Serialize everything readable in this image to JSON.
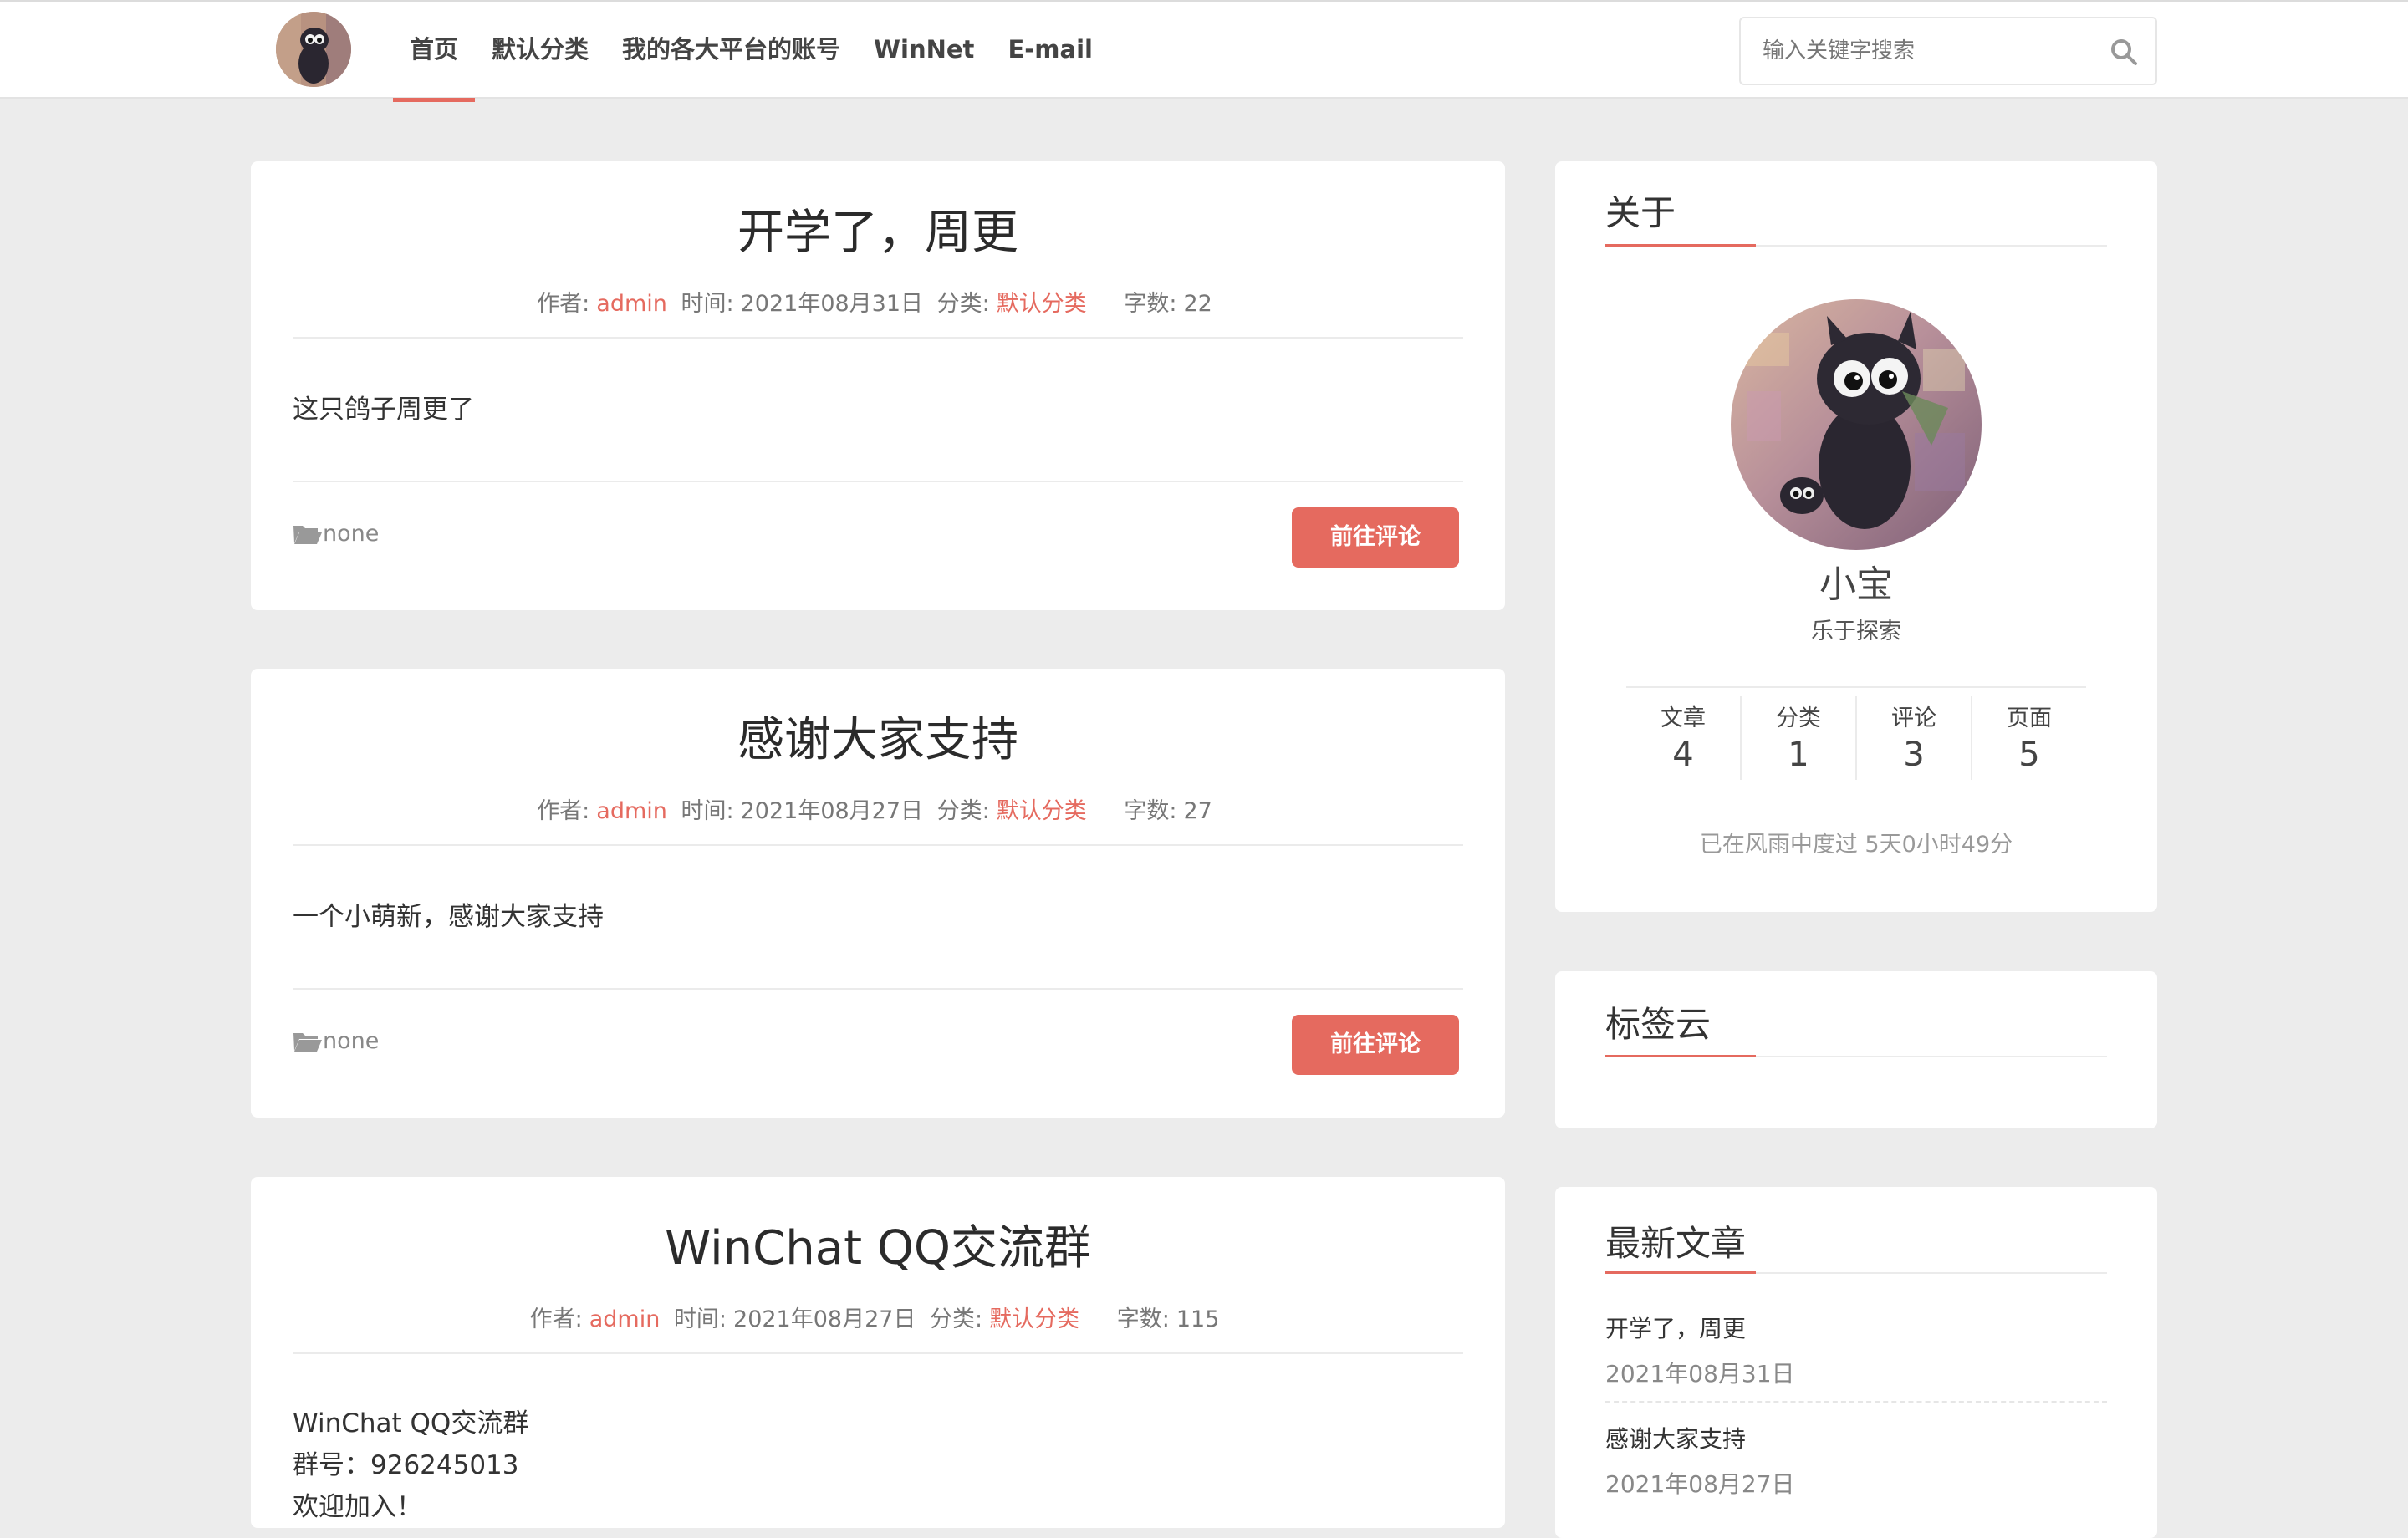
{
  "nav": {
    "items": [
      {
        "label": "首页",
        "active": true
      },
      {
        "label": "默认分类",
        "active": false
      },
      {
        "label": "我的各大平台的账号",
        "active": false
      },
      {
        "label": "WinNet",
        "active": false
      },
      {
        "label": "E-mail",
        "active": false
      }
    ],
    "search_placeholder": "输入关键字搜索"
  },
  "labels": {
    "author": "作者:",
    "time": "时间:",
    "category": "分类:",
    "words": "字数:",
    "comment_button": "前往评论"
  },
  "posts": [
    {
      "title": "开学了，周更",
      "author": "admin",
      "date": "2021年08月31日",
      "category": "默认分类",
      "words": "22",
      "body": [
        "这只鸽子周更了"
      ],
      "tag": "none"
    },
    {
      "title": "感谢大家支持",
      "author": "admin",
      "date": "2021年08月27日",
      "category": "默认分类",
      "words": "27",
      "body": [
        "一个小萌新，感谢大家支持"
      ],
      "tag": "none"
    },
    {
      "title": "WinChat QQ交流群",
      "author": "admin",
      "date": "2021年08月27日",
      "category": "默认分类",
      "words": "115",
      "body": [
        "WinChat QQ交流群",
        "群号：926245013",
        "欢迎加入！"
      ]
    }
  ],
  "sidebar": {
    "about": {
      "title": "关于",
      "name": "小宝",
      "motto": "乐于探索",
      "stats": [
        {
          "label": "文章",
          "value": "4"
        },
        {
          "label": "分类",
          "value": "1"
        },
        {
          "label": "评论",
          "value": "3"
        },
        {
          "label": "页面",
          "value": "5"
        }
      ],
      "runtime": "已在风雨中度过 5天0小时49分"
    },
    "tags": {
      "title": "标签云"
    },
    "recent": {
      "title": "最新文章",
      "items": [
        {
          "title": "开学了，周更",
          "date": "2021年08月31日"
        },
        {
          "title": "感谢大家支持",
          "date": "2021年08月27日"
        }
      ]
    }
  },
  "colors": {
    "accent": "#e56a5f",
    "background": "#ececec"
  }
}
